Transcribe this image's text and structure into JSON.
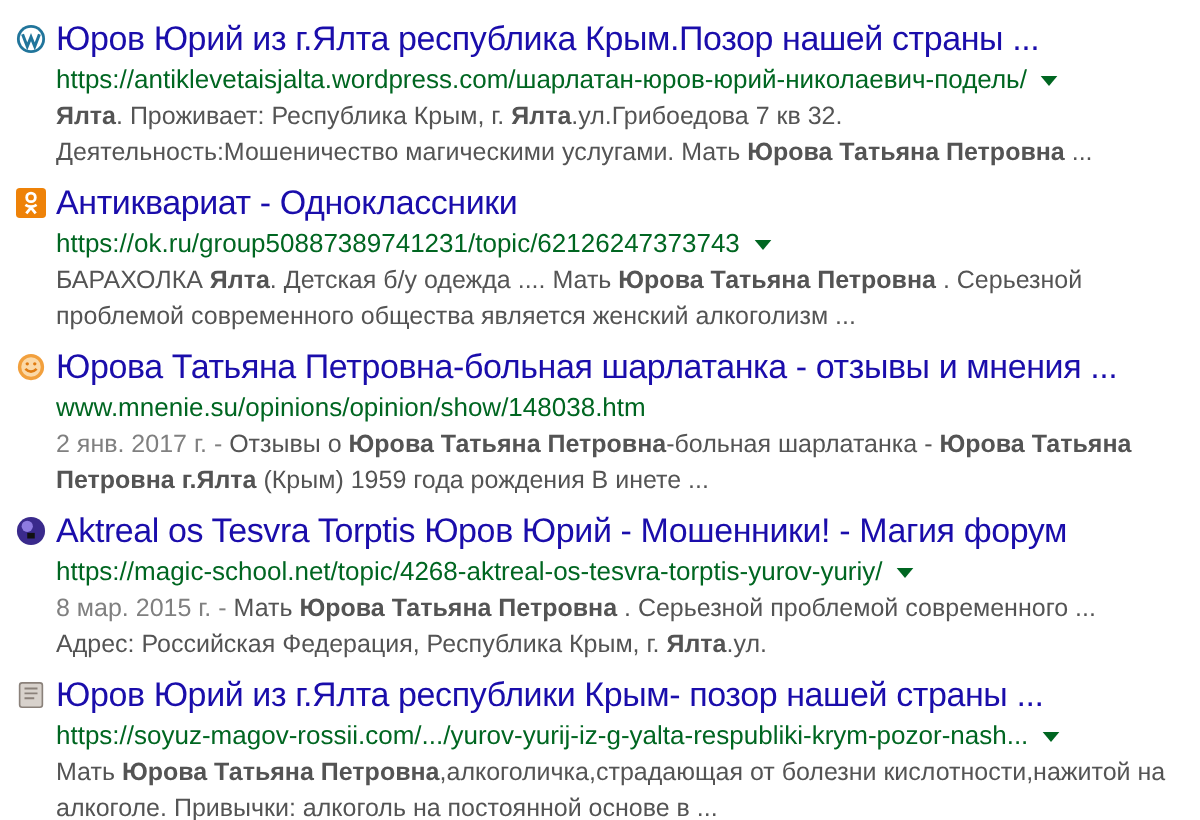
{
  "results": [
    {
      "kind": "wordpress",
      "title": "Юров Юрий из г.Ялта республика Крым.Позор нашей страны ...",
      "url": "https://antiklevetaisjalta.wordpress.com/шарлатан-юров-юрий-николаевич-подель/",
      "caret": true,
      "snippet": "**Ялта**. Проживает: Республика Крым, г. **Ялта**.ул.Грибоедова 7 кв 32. Деятельность:Мошеничество магическими услугами. Мать **Юрова Татьяна Петровна** ..."
    },
    {
      "kind": "ok",
      "title": "Антиквариат - Одноклассники",
      "url": "https://ok.ru/group50887389741231/topic/62126247373743",
      "caret": true,
      "snippet": "БАРАХОЛКА **Ялта**. Детская б/у одежда .... Мать **Юрова Татьяна Петровна** . Серьезной проблемой современного общества является женский алкоголизм ..."
    },
    {
      "kind": "smile",
      "title": "Юрова Татьяна Петровна-больная шарлатанка - отзывы и мнения ...",
      "url": "www.mnenie.su/opinions/opinion/show/148038.htm",
      "caret": false,
      "date": "2 янв. 2017 г. -",
      "snippet": "Отзывы о **Юрова Татьяна Петровна**-больная шарлатанка - **Юрова Татьяна Петровна г.Ялта** (Крым) 1959 года рождения В инете ..."
    },
    {
      "kind": "sphere",
      "title": "Aktreal os Tesvra Torptis Юров Юрий - Мошенники! - Магия форум",
      "url": "https://magic-school.net/topic/4268-aktreal-os-tesvra-torptis-yurov-yuriy/",
      "caret": true,
      "date": "8 мар. 2015 г. -",
      "snippet": "Мать **Юрова Татьяна Петровна** . Серьезной проблемой современного ... Адрес: Российская Федерация, Республика Крым, г. **Ялта**.ул."
    },
    {
      "kind": "document",
      "title": "Юров Юрий из г.Ялта республики Крым- позор нашей страны ...",
      "url": "https://soyuz-magov-rossii.com/.../yurov-yurij-iz-g-yalta-respubliki-krym-pozor-nash...",
      "caret": true,
      "snippet": "Мать **Юрова Татьяна Петровна**,алкоголичка,страдающая от болезни кислотности,нажитой на алкоголе. Привычки: алкоголь на постоянной основе в ..."
    }
  ]
}
